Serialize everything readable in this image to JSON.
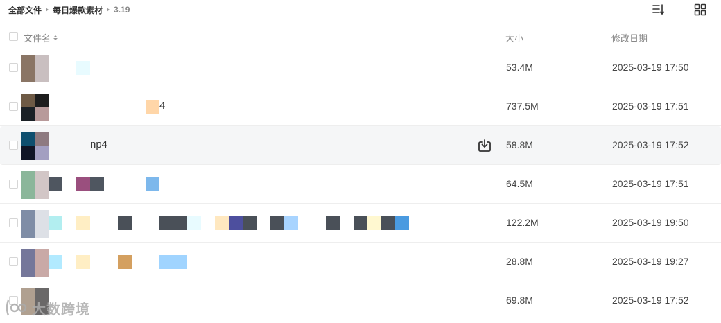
{
  "breadcrumb": {
    "items": [
      "全部文件",
      "每日爆款素材",
      "3.19"
    ]
  },
  "icons": {
    "sort": "sort-list-icon",
    "grid": "grid-view-icon",
    "download": "download-icon"
  },
  "table": {
    "headers": {
      "name": "文件名",
      "size": "大小",
      "date": "修改日期"
    },
    "rows": [
      {
        "name": "",
        "size": "53.4M",
        "date": "2025-03-19 17:50",
        "thumb": [
          "#8a7565",
          "#c9bfc0",
          "#8a7565",
          "#c9bfc0"
        ],
        "mosaic": [
          [
            "#e8fbff",
            110,
            20
          ]
        ]
      },
      {
        "name": "4",
        "size": "737.5M",
        "date": "2025-03-19 17:51",
        "thumb": [
          "#6e5a45",
          "#1d1d1d",
          "#1b2126",
          "#b89a9a"
        ],
        "mosaic": [
          [
            "#ffd6a8",
            210,
            20
          ]
        ]
      },
      {
        "name": "np4",
        "size": "58.8M",
        "date": "2025-03-19 17:52",
        "thumb": [
          "#0e4f6f",
          "#8e7a80",
          "#101526",
          "#a39fc1"
        ],
        "mosaic": [],
        "hover": true
      },
      {
        "name": "",
        "size": "64.5M",
        "date": "2025-03-19 17:51",
        "thumb": [
          "#8bb69a",
          "#d2c6c6",
          "#8bb69a",
          "#d2c6c6"
        ],
        "mosaic": [
          [
            "#4f5660",
            70,
            20
          ],
          [
            "#9a4f7e",
            110,
            20
          ],
          [
            "#4f5660",
            130,
            20
          ],
          [
            "#7db8ec",
            210,
            20
          ]
        ]
      },
      {
        "name": "",
        "size": "122.2M",
        "date": "2025-03-19 19:50",
        "thumb": [
          "#7f8da6",
          "#dde0e6",
          "#7f8da6",
          "#dde0e6"
        ],
        "mosaic": [
          [
            "#b2eef0",
            70,
            20
          ],
          [
            "#ffeec4",
            110,
            20
          ],
          [
            "#4a5058",
            170,
            20
          ],
          [
            "#4a5058",
            230,
            40
          ],
          [
            "#e8fbff",
            270,
            20
          ],
          [
            "#ffe8c0",
            310,
            20
          ],
          [
            "#4d4f9e",
            330,
            20
          ],
          [
            "#4a5058",
            350,
            20
          ],
          [
            "#4a5058",
            390,
            20
          ],
          [
            "#a8d4ff",
            410,
            20
          ],
          [
            "#4a5058",
            470,
            20
          ],
          [
            "#4a5058",
            510,
            20
          ],
          [
            "#fff8d0",
            530,
            20
          ],
          [
            "#4a5058",
            550,
            20
          ],
          [
            "#4a9ae0",
            570,
            20
          ]
        ]
      },
      {
        "name": "",
        "size": "28.8M",
        "date": "2025-03-19 19:27",
        "thumb": [
          "#75779a",
          "#c9a9a6",
          "#75779a",
          "#c9a9a6"
        ],
        "mosaic": [
          [
            "#b2eaff",
            70,
            20
          ],
          [
            "#ffeec4",
            110,
            20
          ],
          [
            "#d4a060",
            170,
            20
          ],
          [
            "#a0d4ff",
            230,
            40
          ]
        ]
      },
      {
        "name": "",
        "size": "69.8M",
        "date": "2025-03-19 17:52",
        "thumb": [
          "#b0a090",
          "#6a6868",
          "#b0a090",
          "#6a6868"
        ],
        "mosaic": []
      }
    ]
  },
  "watermark": {
    "text": "大数跨境"
  }
}
